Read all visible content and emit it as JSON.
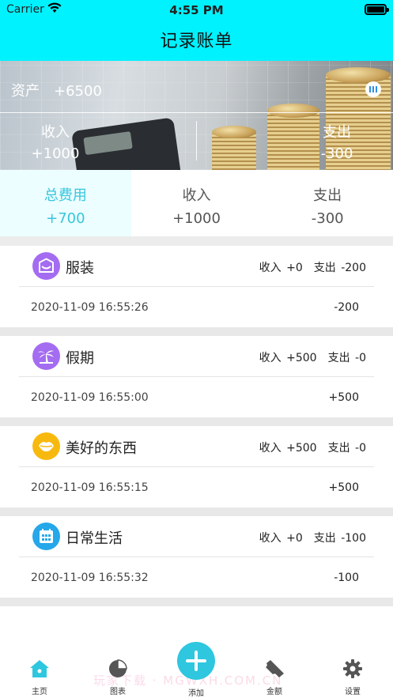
{
  "status_bar": {
    "carrier": "Carrier",
    "time": "4:55 PM"
  },
  "nav": {
    "title": "记录账单"
  },
  "banner": {
    "asset_label": "资产",
    "asset_value": "+6500",
    "income_label": "收入",
    "income_value": "+1000",
    "expense_label": "支出",
    "expense_value": "-300"
  },
  "tabs": [
    {
      "label": "总费用",
      "value": "+700"
    },
    {
      "label": "收入",
      "value": "+1000"
    },
    {
      "label": "支出",
      "value": "-300"
    }
  ],
  "records": [
    {
      "icon": "clothing-bag-icon",
      "color": "#a46cf1",
      "name": "服装",
      "income_label": "收入",
      "income": "+0",
      "expense_label": "支出",
      "expense": "-200",
      "date": "2020-11-09 16:55:26",
      "amount": "-200"
    },
    {
      "icon": "palm-tree-icon",
      "color": "#a46cf1",
      "name": "假期",
      "income_label": "收入",
      "income": "+500",
      "expense_label": "支出",
      "expense": "-0",
      "date": "2020-11-09 16:55:00",
      "amount": "+500"
    },
    {
      "icon": "lips-icon",
      "color": "#f8b90f",
      "name": "美好的东西",
      "income_label": "收入",
      "income": "+500",
      "expense_label": "支出",
      "expense": "-0",
      "date": "2020-11-09 16:55:15",
      "amount": "+500"
    },
    {
      "icon": "calendar-icon",
      "color": "#25a7ea",
      "name": "日常生活",
      "income_label": "收入",
      "income": "+0",
      "expense_label": "支出",
      "expense": "-100",
      "date": "2020-11-09 16:55:32",
      "amount": "-100"
    }
  ],
  "tabbar": {
    "home": "主页",
    "chart": "图表",
    "add": "添加",
    "amount": "金额",
    "settings": "设置"
  },
  "watermark": "玩家下载 · MGWXH.COM.CN",
  "colors": {
    "nav": "#00f2ff",
    "accent": "#37c6dc",
    "tab_active_bg": "#ecfeff"
  }
}
